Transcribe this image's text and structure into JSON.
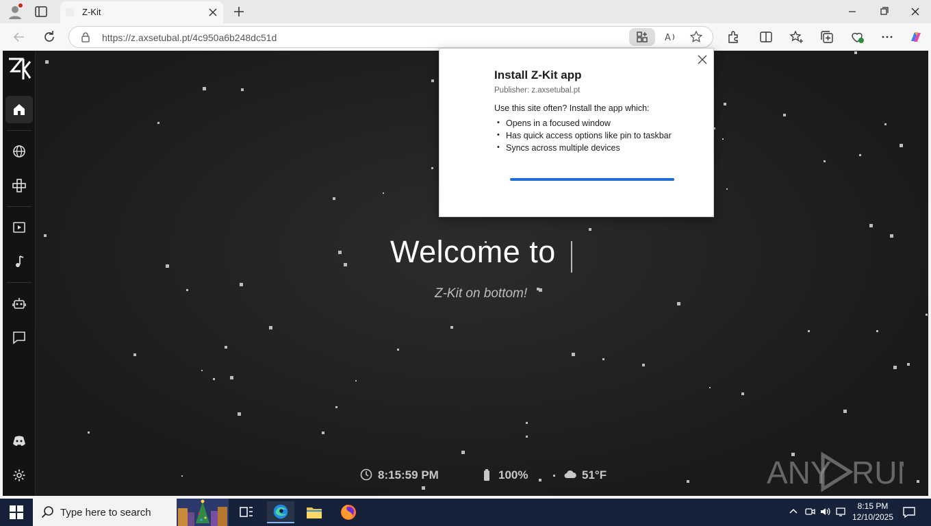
{
  "browser": {
    "tab_title": "Z-Kit",
    "url": "https://z.axsetubal.pt/4c950a6b248dc51d"
  },
  "page": {
    "welcome": "Welcome to",
    "subtitle": "Z-Kit on bottom!",
    "status": {
      "time": "8:15:59 PM",
      "battery": "100%",
      "weather": "51°F"
    },
    "watermark": "ANY RUN"
  },
  "sidebar": {
    "items": [
      "home-icon",
      "globe-icon",
      "gamepad-icon",
      "video-icon",
      "music-icon",
      "robot-icon",
      "chat-icon",
      "discord-icon",
      "settings-icon"
    ]
  },
  "install_popup": {
    "title": "Install Z-Kit app",
    "publisher": "Publisher: z.axsetubal.pt",
    "lead": "Use this site often? Install the app which:",
    "bullets": [
      "Opens in a focused window",
      "Has quick access options like pin to taskbar",
      "Syncs across multiple devices"
    ]
  },
  "taskbar": {
    "search_placeholder": "Type here to search",
    "time": "8:15 PM",
    "date": "12/10/2025"
  },
  "colors": {
    "accent": "#1f6fd1",
    "taskbar": "#16213a",
    "page_bg": "#222222"
  }
}
